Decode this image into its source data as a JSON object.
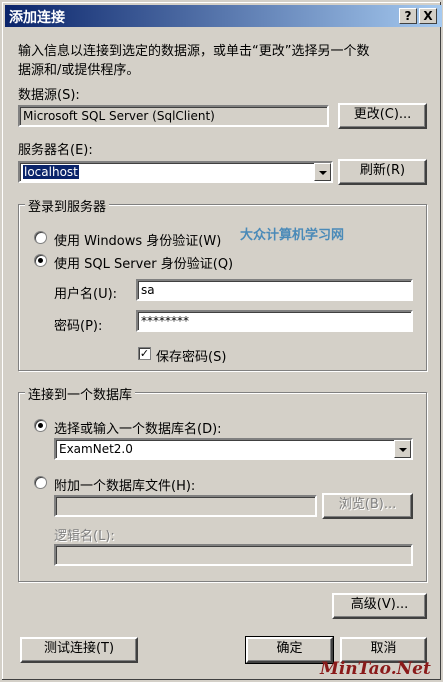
{
  "title": "添加连接",
  "titlebar_buttons": {
    "help": "?",
    "close": "X"
  },
  "intro": [
    "输入信息以连接到选定的数据源，或单击“更改”选择另一个数",
    "据源和/或提供程序。"
  ],
  "datasource": {
    "label": "数据源(S):",
    "value": "Microsoft SQL Server (SqlClient)",
    "change_button": "更改(C)..."
  },
  "server": {
    "label": "服务器名(E):",
    "value": "localhost",
    "refresh_button": "刷新(R)"
  },
  "login": {
    "legend": "登录到服务器",
    "windows_auth": "使用 Windows 身份验证(W)",
    "sql_auth": "使用 SQL Server 身份验证(Q)",
    "username_label": "用户名(U):",
    "username": "sa",
    "password_label": "密码(P):",
    "password": "********",
    "save_password": "保存密码(S)",
    "save_password_checked": true
  },
  "database": {
    "legend": "连接到一个数据库",
    "select_option": "选择或输入一个数据库名(D):",
    "database_name": "ExamNet2.0",
    "attach_option": "附加一个数据库文件(H):",
    "browse_button": "浏览(B)...",
    "logical_name_label": "逻辑名(L):"
  },
  "advanced_button": "高级(V)...",
  "test_button": "测试连接(T)",
  "ok_button": "确定",
  "cancel_button": "取消",
  "watermark_logo": "大众计算机学习网",
  "watermark_site": "MinTao.Net"
}
